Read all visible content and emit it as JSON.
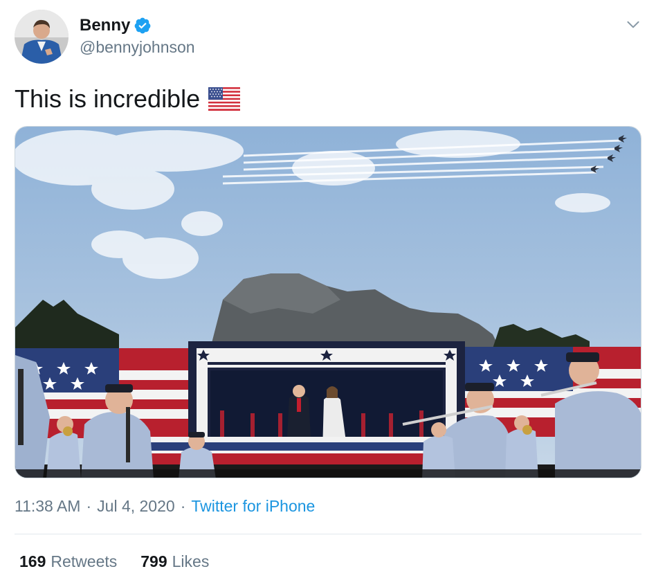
{
  "author": {
    "display_name": "Benny",
    "handle": "@bennyjohnson",
    "verified": true
  },
  "tweet": {
    "text": "This is incredible",
    "emoji": "us-flag"
  },
  "meta": {
    "time": "11:38 AM",
    "date": "Jul 4, 2020",
    "separator": "·",
    "source": "Twitter for iPhone"
  },
  "stats": {
    "retweets_count": "169",
    "retweets_label": "Retweets",
    "likes_count": "799",
    "likes_label": "Likes"
  },
  "icons": {
    "verified": "verified-badge-icon",
    "menu": "chevron-down-icon"
  },
  "colors": {
    "link": "#1b95e0",
    "secondary_text": "#657786",
    "verified": "#1da1f2"
  }
}
